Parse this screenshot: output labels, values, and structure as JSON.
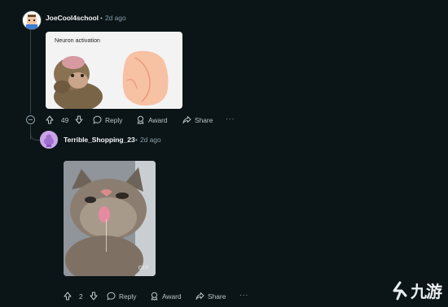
{
  "comments": [
    {
      "username": "JoeCool4school",
      "separator": "•",
      "time": "2d ago",
      "image_caption": "Neuron activation",
      "votes": "49",
      "actions": {
        "reply": "Reply",
        "award": "Award",
        "share": "Share",
        "more": "···"
      }
    },
    {
      "username": "Terrible_Shopping_23",
      "separator": "•",
      "time": "2d ago",
      "gif_badge": "GIF",
      "votes": "2",
      "actions": {
        "reply": "Reply",
        "award": "Award",
        "share": "Share",
        "more": "···"
      }
    }
  ],
  "watermark": {
    "text": "九游"
  },
  "colors": {
    "background": "#0b1416",
    "meta": "#8ba2ad",
    "text": "#d7dadc"
  },
  "icons": [
    "upvote-icon",
    "downvote-icon",
    "reply-icon",
    "award-icon",
    "share-icon",
    "more-icon",
    "collapse-icon",
    "avatar-icon"
  ]
}
